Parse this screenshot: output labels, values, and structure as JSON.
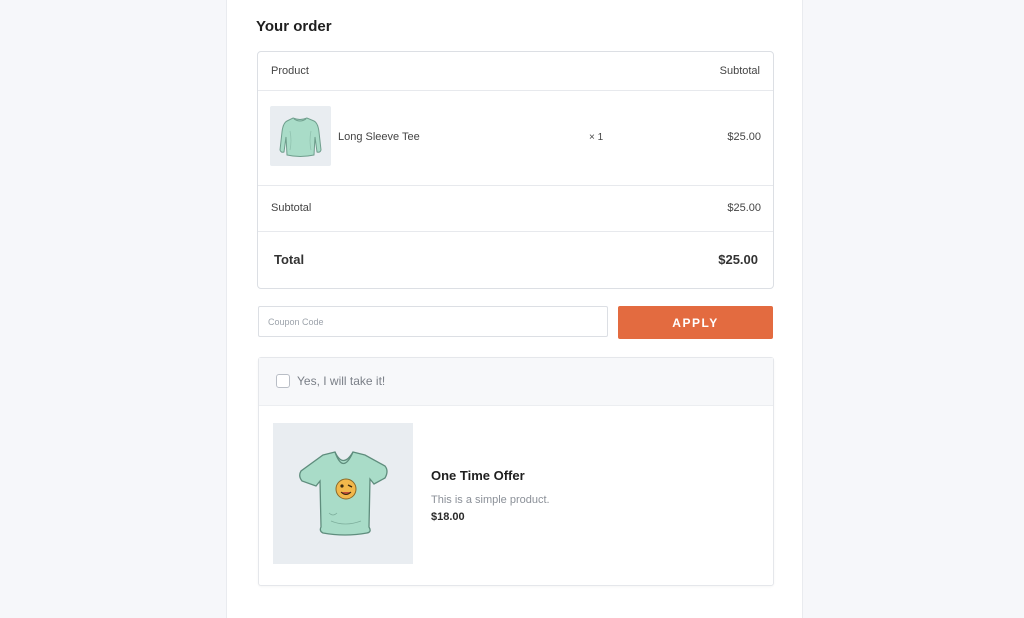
{
  "order": {
    "title": "Your order",
    "columns": {
      "product": "Product",
      "subtotal": "Subtotal"
    },
    "items": [
      {
        "name": "Long Sleeve Tee",
        "quantity": "× 1",
        "price": "$25.00",
        "image_icon": "long-sleeve-tee-icon"
      }
    ],
    "subtotal_label": "Subtotal",
    "subtotal_value": "$25.00",
    "total_label": "Total",
    "total_value": "$25.00"
  },
  "coupon": {
    "placeholder": "Coupon Code",
    "value": "",
    "apply_label": "APPLY",
    "apply_color": "#e36b40"
  },
  "offer": {
    "checkbox_label": "Yes, I will take it!",
    "checked": false,
    "title": "One Time Offer",
    "description": "This is a simple product.",
    "price": "$18.00",
    "image_icon": "v-neck-tee-icon"
  }
}
